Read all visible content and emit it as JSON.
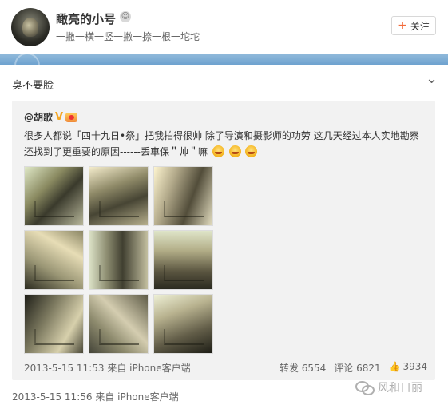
{
  "header": {
    "username": "瞰亮的小号",
    "motto": "一撇一横一竖一撇一捺一根一坨坨",
    "follow_label": "关注",
    "follow_plus": "+",
    "user_icon_glyph": "☺"
  },
  "post": {
    "text": "臭不要脸",
    "chevron_glyph": "⌄"
  },
  "repost": {
    "user": "@胡歌",
    "verify_glyph": "V",
    "text": "很多人都说「四十九日•祭」把我拍得很帅 除了导演和摄影师的功劳 这几天经过本人实地勘察 还找到了更重要的原因------丢車保＂帅＂嘛",
    "time_source": "2013-5-15 11:53 来自 iPhone客户端",
    "repost_label": "转发 6554",
    "comment_label": "评论 6821",
    "like_count": "3934",
    "like_glyph": "👍"
  },
  "outer": {
    "time_source": "2013-5-15 11:56 来自 iPhone客户端"
  },
  "watermark": {
    "text": "风和日丽"
  },
  "colors": {
    "accent": "#f36b3b",
    "blue_bar": "#6ea2cf",
    "repost_bg": "#f2f2f2"
  }
}
